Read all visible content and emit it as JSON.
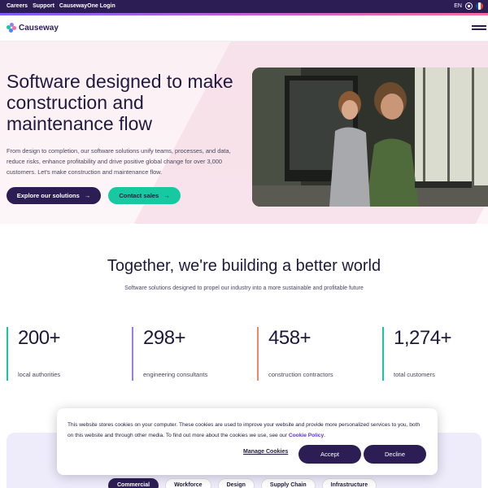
{
  "topbar": {
    "links": [
      "Careers",
      "Support",
      "CausewayOne Login"
    ],
    "language": "EN"
  },
  "navbar": {
    "logo_text": "Causeway"
  },
  "hero": {
    "title": "Software designed to make construction and maintenance flow",
    "description": "From design to completion, our software solutions unify teams, processes, and data, reduce risks, enhance profitability and drive positive global change for over 3,000 customers. Let's make construction and maintenance flow.",
    "primary_cta": "Explore our solutions",
    "secondary_cta": "Contact sales"
  },
  "mission": {
    "title": "Together, we're building a better world",
    "subtitle": "Software solutions designed to propel our industry into a more sustainable and profitable future"
  },
  "stats": [
    {
      "value": "200+",
      "label": "local authorities",
      "color": "#17c9a1"
    },
    {
      "value": "298+",
      "label": "engineering consultants",
      "color": "#9b7cf0"
    },
    {
      "value": "458+",
      "label": "construction contractors",
      "color": "#f0866a"
    },
    {
      "value": "1,274+",
      "label": "total customers",
      "color": "#17c9a1"
    }
  ],
  "tabs": [
    "Commercial",
    "Workforce",
    "Design",
    "Supply Chain",
    "Infrastructure"
  ],
  "active_tab": "Commercial",
  "cookie_banner": {
    "text": "This website stores cookies on your computer. These cookies are used to improve your website and provide more personalized services to you, both on this website and through other media. To find out more about the cookies we use, see our",
    "policy_link": "Cookie Policy",
    "manage_label": "Manage Cookies",
    "accept_label": "Accept",
    "decline_label": "Decline"
  },
  "colors": {
    "brand_dark": "#2c1d55",
    "accent_green": "#17c9a1",
    "link_purple": "#5a33e0"
  }
}
